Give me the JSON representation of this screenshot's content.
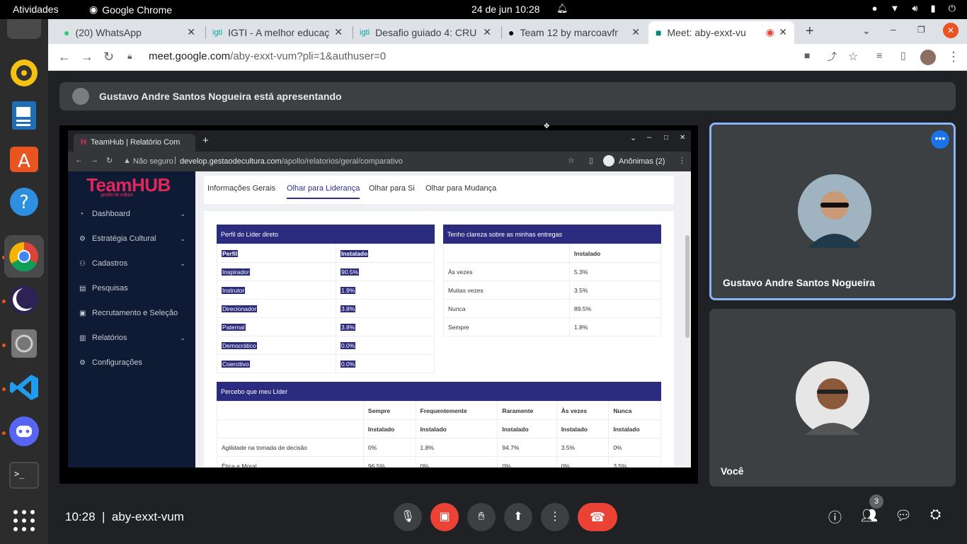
{
  "topbar": {
    "activities": "Atividades",
    "app_name": "Google Chrome",
    "datetime": "24 de jun  10:28"
  },
  "chrome": {
    "tabs": [
      {
        "label": "(20) WhatsApp",
        "icon": "whatsapp-icon"
      },
      {
        "label": "IGTI - A melhor educaç",
        "icon": "igti-icon"
      },
      {
        "label": "Desafio guiado 4: CRU",
        "icon": "igti-icon"
      },
      {
        "label": "Team 12 by marcoavfr",
        "icon": "github-icon"
      },
      {
        "label": "Meet: aby-exxt-vu",
        "icon": "meet-icon",
        "active": true
      }
    ],
    "url_host": "meet.google.com",
    "url_path": "/aby-exxt-vum?pli=1&authuser=0"
  },
  "meet": {
    "presenter_banner": "Gustavo Andre Santos Nogueira está apresentando",
    "participants": [
      {
        "name": "Gustavo Andre Santos Nogueira"
      },
      {
        "name": "Você"
      }
    ],
    "time": "10:28",
    "meeting_code": "aby-exxt-vum",
    "participants_count": "3"
  },
  "shared": {
    "tab_title": "TeamHub | Relatório Com",
    "not_secure": "Não seguro",
    "url_host": "develop.gestaodecultura.com",
    "url_path": "/apollo/relatorios/geral/comparativo",
    "incognito": "Anônimas (2)",
    "logo": "TeamHUB",
    "logo_sub": "gestão de cultura",
    "sidebar": [
      {
        "label": "Dashboard",
        "chevron": true
      },
      {
        "label": "Estratégia Cultural",
        "chevron": true
      },
      {
        "label": "Cadastros",
        "chevron": true
      },
      {
        "label": "Pesquisas",
        "chevron": false
      },
      {
        "label": "Recrutamento e Seleção",
        "chevron": false
      },
      {
        "label": "Relatórios",
        "chevron": true
      },
      {
        "label": "Configurações",
        "chevron": false
      }
    ],
    "subtabs": [
      "Informações Gerais",
      "Olhar para Liderança",
      "Olhar para Si",
      "Olhar para Mudança"
    ],
    "table1": {
      "title": "Perfil do Líder direto",
      "headers": [
        "Perfil",
        "Instalado"
      ],
      "rows": [
        [
          "Inspirador",
          "90.5%"
        ],
        [
          "Instrutor",
          "1.9%"
        ],
        [
          "Direcionador",
          "3.8%"
        ],
        [
          "Paternal",
          "3.8%"
        ],
        [
          "Democrático",
          "0.0%"
        ],
        [
          "Coercitivo",
          "0.0%"
        ]
      ]
    },
    "table2": {
      "title": "Tenho clareza sobre as minhas entregas",
      "header": "Instalado",
      "rows": [
        [
          "Às vezes",
          "5.3%"
        ],
        [
          "Muitas vezes",
          "3.5%"
        ],
        [
          "Nunca",
          "89.5%"
        ],
        [
          "Sempre",
          "1.8%"
        ]
      ]
    },
    "table3": {
      "title": "Percebo que meu Líder",
      "headers": [
        "Sempre",
        "Frequentemente",
        "Raramente",
        "Às vezes",
        "Nunca"
      ],
      "subheader": "Instalado",
      "rows": [
        [
          "Agilidade na tomada de decisão",
          "0%",
          "1.8%",
          "94.7%",
          "3.5%",
          "0%"
        ],
        [
          "Ética e Moral",
          "96.5%",
          "0%",
          "0%",
          "0%",
          "3.5%"
        ]
      ]
    }
  }
}
